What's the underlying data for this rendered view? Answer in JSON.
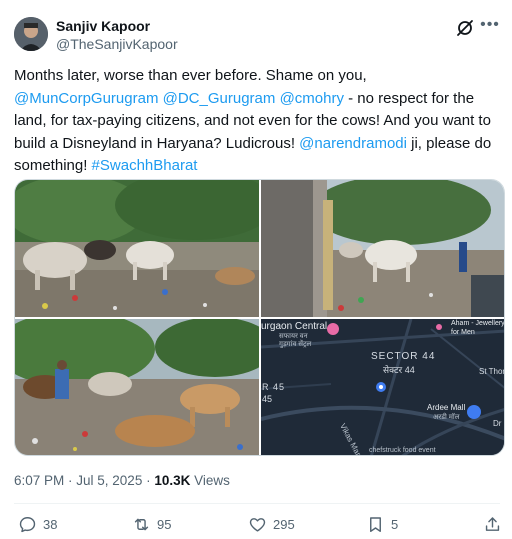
{
  "author": {
    "display_name": "Sanjiv Kapoor",
    "handle": "@TheSanjivKapoor"
  },
  "header_icons": {
    "grok": "grok-icon",
    "more": "more-dots-icon"
  },
  "tweet": {
    "seg1": "Months later, worse than ever before. Shame on you, ",
    "mention1": "@MunCorpGurugram",
    "seg2": " ",
    "mention2": "@DC_Gurugram",
    "seg3": " ",
    "mention3": "@cmohry",
    "seg4": " - no respect for the land, for tax-paying citizens, and not even for the cows! And you want to build a Disneyland in Haryana? Ludicrous! ",
    "mention4": "@narendramodi",
    "seg5": " ji, please do something! ",
    "hashtag": "#SwachhBharat",
    "link_color": "#1d9bf0"
  },
  "media": {
    "map": {
      "place1": "urgaon Central",
      "place1_local": "गुड़गांव सेंट्रल",
      "place1_sub": "सफायर वन",
      "sector": "SECTOR 44",
      "sector_local": "सेक्टर 44",
      "sector45_line1": "R 45",
      "sector45_line2": "45",
      "aham": "Aham - Jewellery",
      "aham2": "for Men",
      "st_thomas": "St Thom",
      "ardee": "Ardee Mall",
      "ardee_local": "अरडी मॉल",
      "vikas_marg": "Vikas Marg",
      "chefstruck": "chefstruck food event",
      "dr": "Dr"
    }
  },
  "meta": {
    "time": "6:07 PM · Jul 5, 2025 · ",
    "views_count": "10.3K",
    "views_label": " Views"
  },
  "actions": {
    "replies": "38",
    "reposts": "95",
    "likes": "295",
    "bookmarks": "5"
  }
}
